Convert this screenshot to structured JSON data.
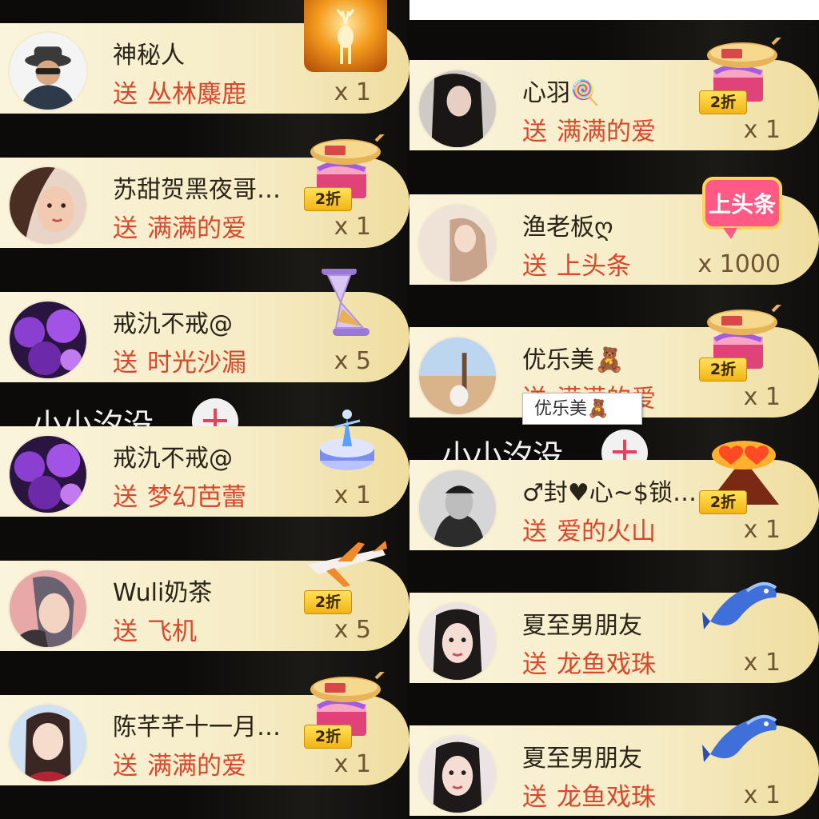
{
  "verb": "送",
  "left_column": {
    "rows": [
      {
        "user": "神秘人",
        "gift": "丛林麋鹿",
        "count": "x 1",
        "discount": "",
        "gift_icon": "deer-gift-icon",
        "avatar": "masked-figure-avatar"
      },
      {
        "user": "苏甜贺黑夜哥…",
        "gift": "满满的爱",
        "count": "x 1",
        "discount": "2折",
        "gift_icon": "love-airship-icon",
        "avatar": "girl-photo-avatar"
      },
      {
        "user": "戒氿不戒@",
        "gift": "时光沙漏",
        "count": "x 5",
        "discount": "",
        "gift_icon": "hourglass-icon",
        "avatar": "purple-flowers-avatar"
      },
      {
        "user": "戒氿不戒@",
        "gift": "梦幻芭蕾",
        "count": "x 1",
        "discount": "",
        "gift_icon": "ballet-music-box-icon",
        "avatar": "purple-flowers-avatar"
      },
      {
        "user": "Wuli奶茶",
        "gift": "飞机",
        "count": "x 5",
        "discount": "2折",
        "gift_icon": "airplane-icon",
        "avatar": "girl-photo-avatar"
      },
      {
        "user": "陈芊芊十一月…",
        "gift": "满满的爱",
        "count": "x 1",
        "discount": "2折",
        "gift_icon": "love-airship-icon",
        "avatar": "girl-photo-avatar"
      }
    ],
    "follow": {
      "name": "小小汐没",
      "button": "+"
    }
  },
  "right_column": {
    "rows": [
      {
        "user": "心羽🍭",
        "gift": "满满的爱",
        "count": "x 1",
        "discount": "2折",
        "gift_icon": "love-airship-icon",
        "avatar": "girl-photo-avatar"
      },
      {
        "user": "渔老板ღ",
        "gift": "上头条",
        "count": "x 1000",
        "discount": "",
        "gift_icon": "headline-badge-icon",
        "avatar": "girl-photo-avatar"
      },
      {
        "user": "优乐美🧸",
        "gift": "满满的爱",
        "count": "x 1",
        "discount": "2折",
        "gift_icon": "love-airship-icon",
        "avatar": "desert-photo-avatar"
      },
      {
        "user": "♂封♥心~$锁…",
        "gift": "爱的火山",
        "count": "x 1",
        "discount": "2折",
        "gift_icon": "love-volcano-icon",
        "avatar": "boy-photo-avatar"
      },
      {
        "user": "夏至男朋友",
        "gift": "龙鱼戏珠",
        "count": "x 1",
        "discount": "",
        "gift_icon": "dragon-fish-icon",
        "avatar": "girl-photo-avatar"
      },
      {
        "user": "夏至男朋友",
        "gift": "龙鱼戏珠",
        "count": "x 1",
        "discount": "",
        "gift_icon": "dragon-fish-icon",
        "avatar": "girl-photo-avatar"
      }
    ],
    "follow": {
      "name": "小小汐没",
      "button": "+"
    },
    "tooltip": "优乐美🧸"
  },
  "gift_headline_text": "上头条",
  "colors": {
    "pill": "#f6ecc6",
    "gift_text": "#d8482c",
    "username": "#2a2418",
    "background": "#0c0b09"
  }
}
